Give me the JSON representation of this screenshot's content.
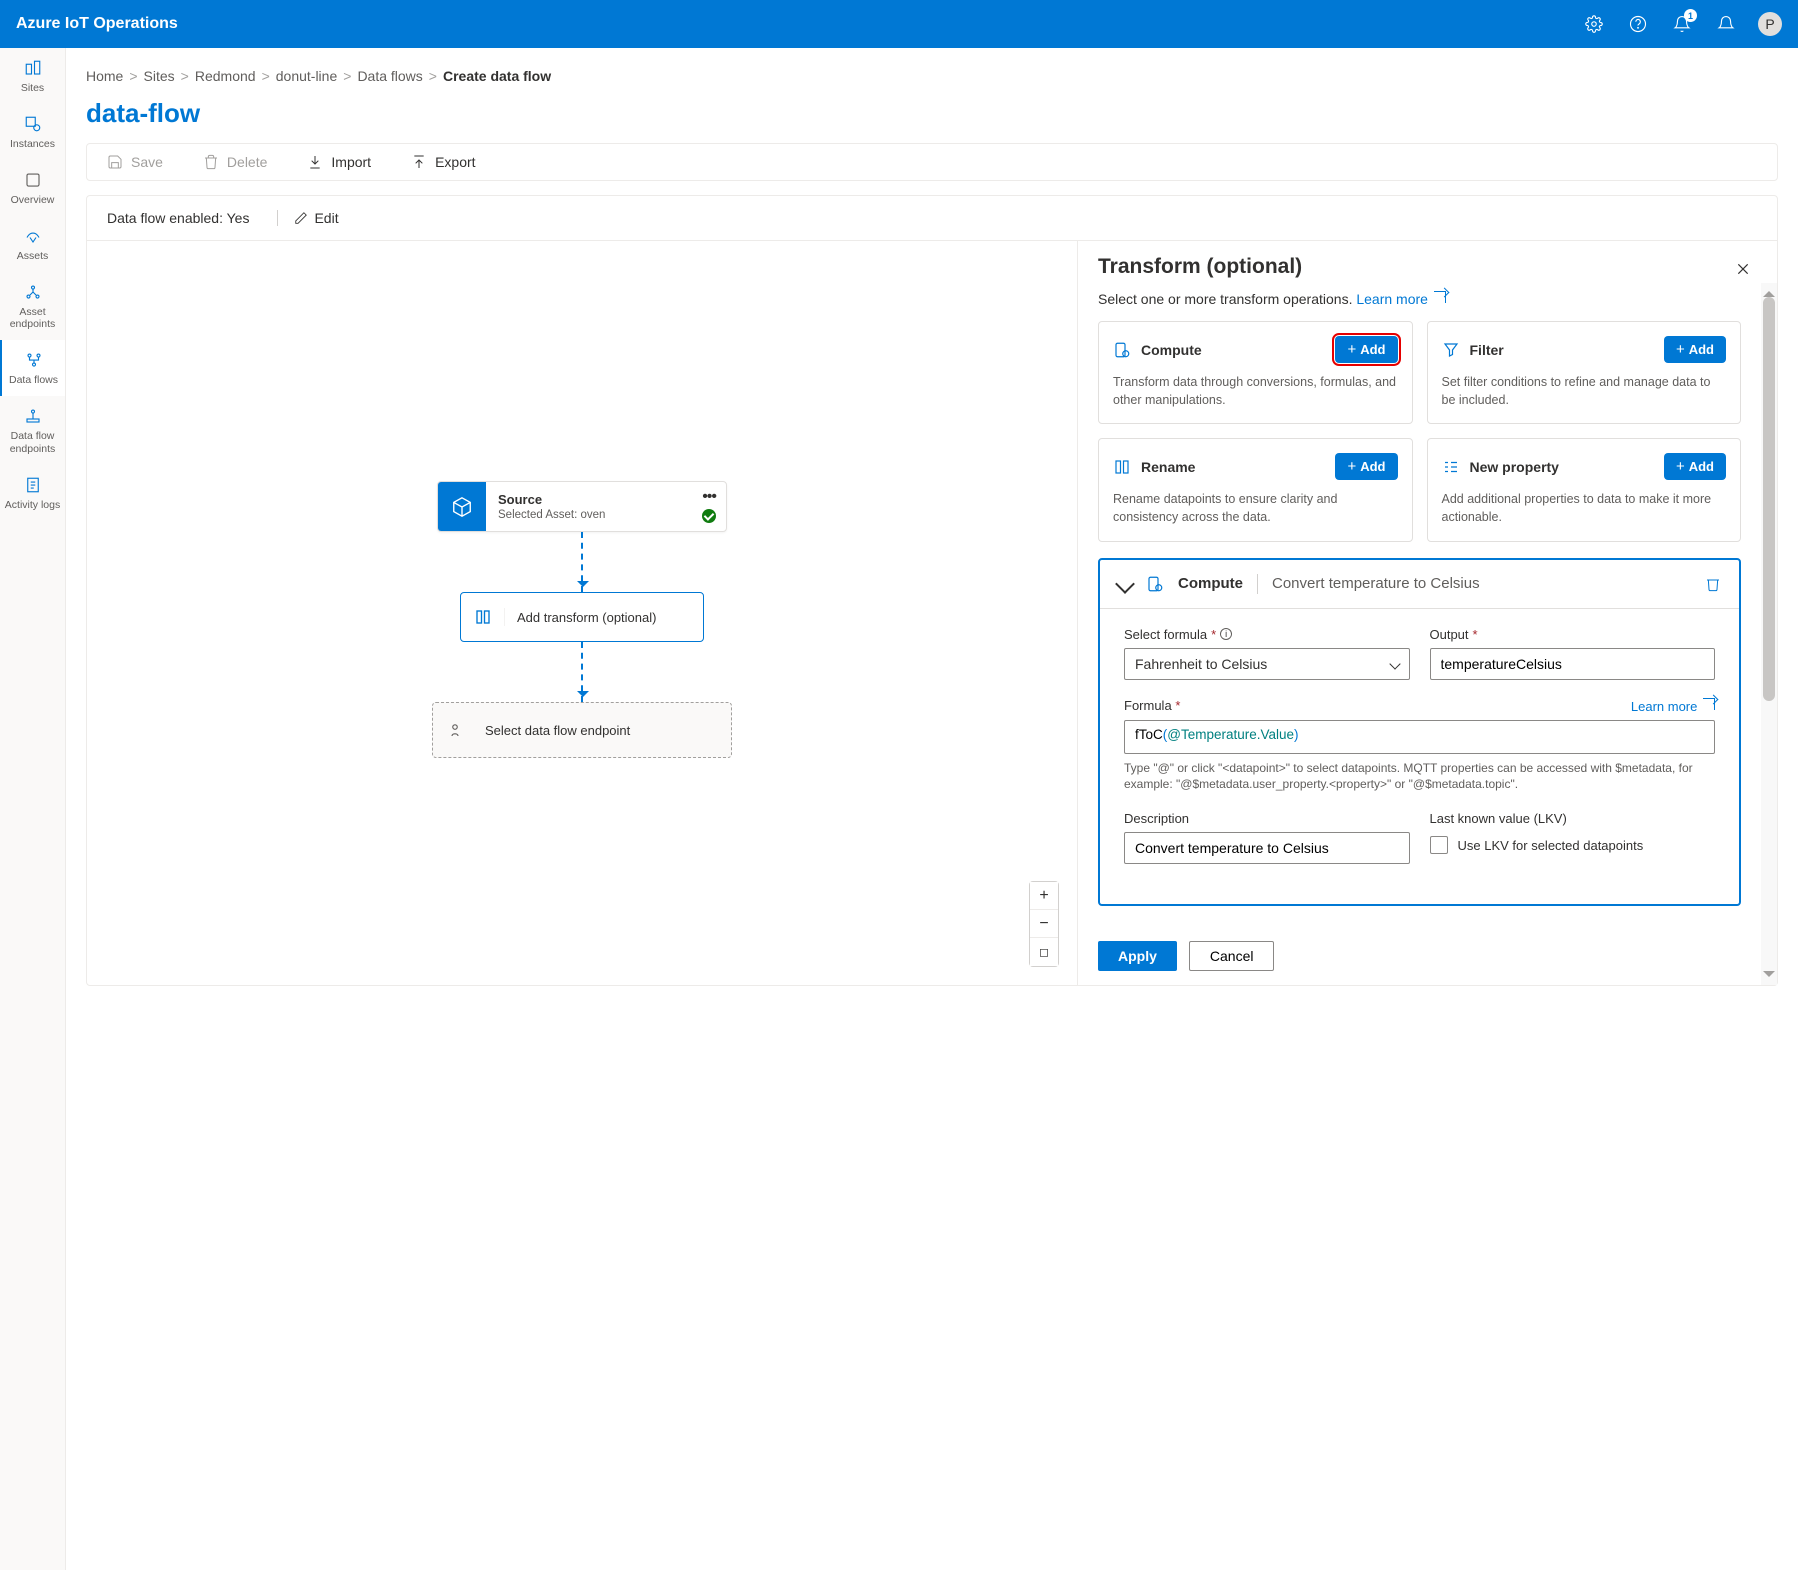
{
  "topbar": {
    "title": "Azure IoT Operations",
    "notification_count": "1",
    "avatar_initial": "P"
  },
  "left_nav": {
    "items": [
      {
        "label": "Sites"
      },
      {
        "label": "Instances"
      },
      {
        "label": "Overview"
      },
      {
        "label": "Assets"
      },
      {
        "label": "Asset endpoints"
      },
      {
        "label": "Data flows"
      },
      {
        "label": "Data flow endpoints"
      },
      {
        "label": "Activity logs"
      }
    ]
  },
  "breadcrumb": {
    "items": [
      "Home",
      "Sites",
      "Redmond",
      "donut-line",
      "Data flows"
    ],
    "current": "Create data flow"
  },
  "page_title": "data-flow",
  "toolbar": {
    "save": "Save",
    "delete": "Delete",
    "import": "Import",
    "export": "Export"
  },
  "status": {
    "label": "Data flow enabled: Yes",
    "edit": "Edit"
  },
  "flow": {
    "source": {
      "title": "Source",
      "subtitle": "Selected Asset: oven"
    },
    "transform": {
      "label": "Add transform (optional)"
    },
    "destination": {
      "label": "Select data flow endpoint"
    }
  },
  "panel": {
    "title": "Transform (optional)",
    "subtext": "Select one or more transform operations. ",
    "learn_more": "Learn more",
    "ops": {
      "compute": {
        "title": "Compute",
        "desc": "Transform data through conversions, formulas, and other manipulations.",
        "add": "Add"
      },
      "filter": {
        "title": "Filter",
        "desc": "Set filter conditions to refine and manage data to be included.",
        "add": "Add"
      },
      "rename": {
        "title": "Rename",
        "desc": "Rename datapoints to ensure clarity and consistency across the data.",
        "add": "Add"
      },
      "newprop": {
        "title": "New property",
        "desc": "Add additional properties to data to make it more actionable.",
        "add": "Add"
      }
    },
    "compute_expand": {
      "head_label": "Compute",
      "head_sub": "Convert temperature to Celsius",
      "select_formula_label": "Select formula",
      "select_formula_value": "Fahrenheit to Celsius",
      "output_label": "Output",
      "output_value": "temperatureCelsius",
      "formula_label": "Formula",
      "formula_learn": "Learn more",
      "formula_fn": "fToC",
      "formula_arg": "@Temperature.Value",
      "formula_hint": "Type \"@\" or click \"<datapoint>\" to select datapoints. MQTT properties can be accessed with $metadata, for example: \"@$metadata.user_property.<property>\" or \"@$metadata.topic\".",
      "description_label": "Description",
      "description_value": "Convert temperature to Celsius",
      "lkv_label": "Last known value (LKV)",
      "lkv_checkbox": "Use LKV for selected datapoints"
    },
    "footer": {
      "apply": "Apply",
      "cancel": "Cancel"
    }
  }
}
